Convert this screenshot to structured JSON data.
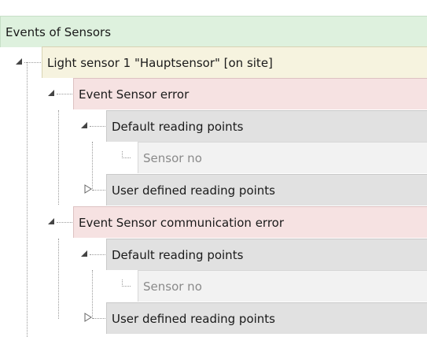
{
  "tree": {
    "root": {
      "label": "Events of Sensors"
    },
    "sensor": {
      "label": "Light sensor 1 \"Hauptsensor\" [on site]"
    },
    "events": [
      {
        "label": "Event Sensor error",
        "default_group": {
          "label": "Default reading points",
          "expanded": true,
          "items": [
            "Sensor no"
          ]
        },
        "user_group": {
          "label": "User defined reading points",
          "expanded": false
        }
      },
      {
        "label": "Event Sensor communication error",
        "default_group": {
          "label": "Default reading points",
          "expanded": true,
          "items": [
            "Sensor no"
          ]
        },
        "user_group": {
          "label": "User defined reading points",
          "expanded": false
        }
      }
    ]
  },
  "colors": {
    "root_band": "#def1de",
    "sensor_band": "#f6f3df",
    "event_band": "#f6e2e2",
    "group_band": "#e1e1e1",
    "item_band": "#f2f2f2",
    "item_text": "#8a8a8a"
  },
  "icons": {
    "expanded": "expanded-triangle-icon",
    "collapsed": "collapsed-triangle-icon"
  }
}
